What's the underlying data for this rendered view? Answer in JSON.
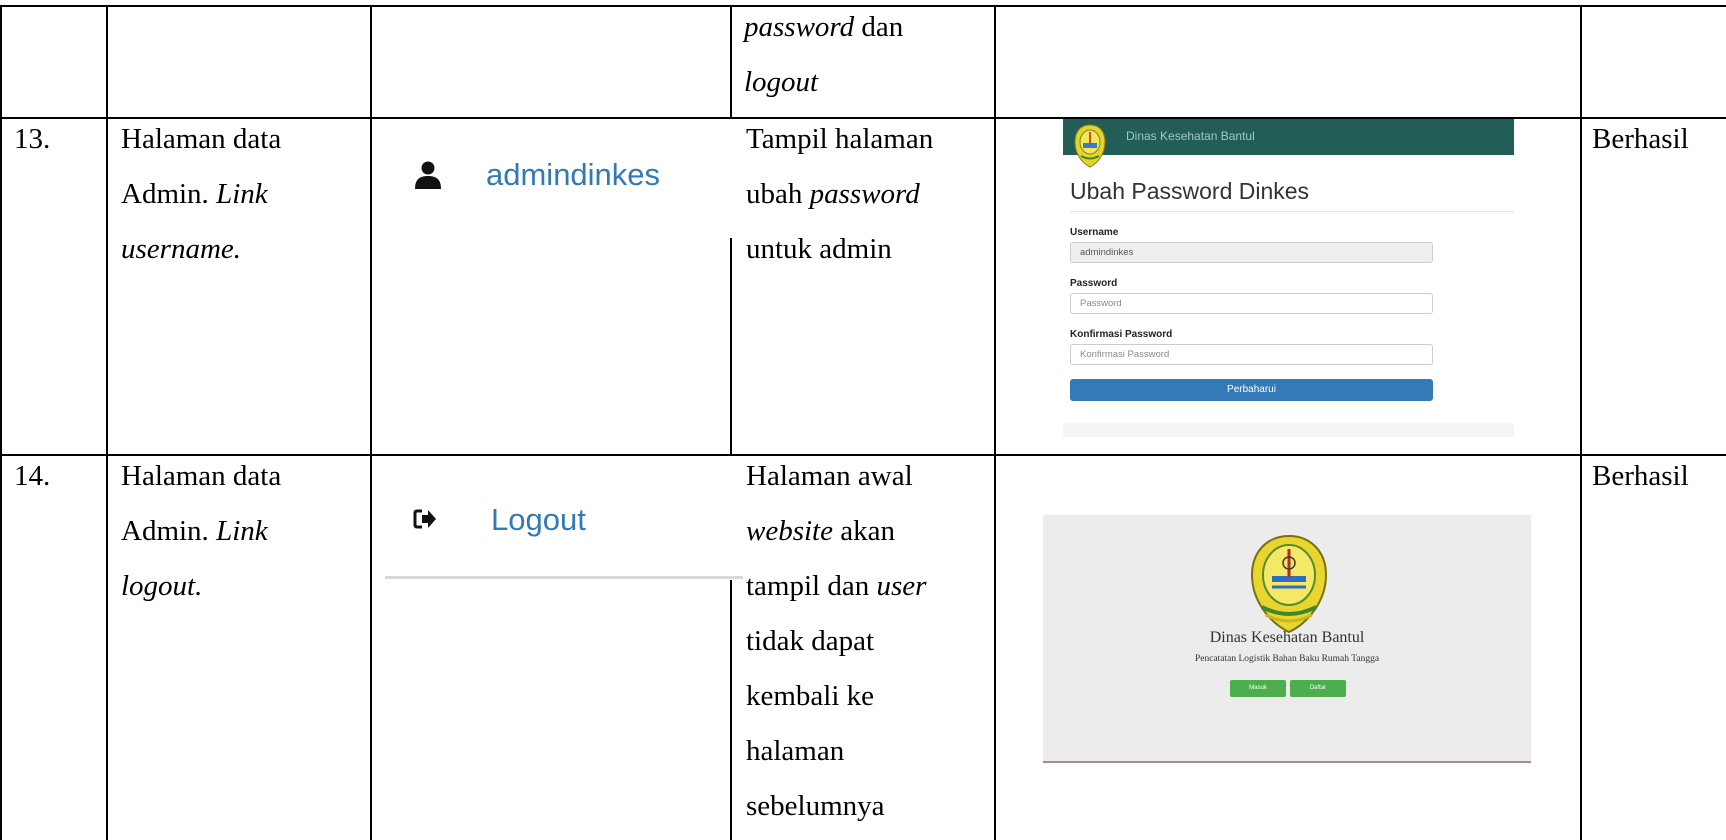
{
  "table": {
    "top_row": {
      "col3_line1": "password",
      "col3_line1_tail": " dan",
      "col3_line2": "logout"
    },
    "rows": [
      {
        "no": "13.",
        "desc_line1": "Halaman data",
        "desc_line2_plain": "Admin. ",
        "desc_line2_italic": "Link",
        "desc_line3_italic": "username.",
        "link_label": "admindinkes",
        "link_icon": "user-icon",
        "result_line1": "Tampil halaman",
        "result_line2_plain": "ubah ",
        "result_line2_italic": "password",
        "result_line3": "untuk admin",
        "status": "Berhasil"
      },
      {
        "no": "14.",
        "desc_line1": "Halaman data",
        "desc_line2_plain": "Admin. ",
        "desc_line2_italic": "Link",
        "desc_line3_italic": "logout.",
        "link_label": "Logout",
        "link_icon": "sign-out-icon",
        "result_line1": "Halaman awal",
        "result_line2_italic": "website",
        "result_line2_plain": " akan",
        "result_line3_plain": "tampil dan ",
        "result_line3_italic": "user",
        "result_line4": "tidak dapat",
        "result_line5": "kembali ke",
        "result_line6": "halaman",
        "result_line7": "sebelumnya",
        "status": "Berhasil"
      }
    ]
  },
  "screenshot13": {
    "header_title": "Dinas Kesehatan Bantul",
    "page_title": "Ubah Password Dinkes",
    "username_label": "Username",
    "username_value": "admindinkes",
    "password_label": "Password",
    "password_placeholder": "Password",
    "confirm_label": "Konfirmasi Password",
    "confirm_placeholder": "Konfirmasi Password",
    "submit_label": "Perbaharui",
    "header_color": "#225e57",
    "button_color": "#337ab7"
  },
  "screenshot14": {
    "title": "Dinas Kesehatan Bantul",
    "subtitle": "Pencatatan Logistik Bahan Baku Rumah Tangga",
    "login_label": "Masuk",
    "register_label": "Daftar",
    "button_color": "#4cae4c"
  }
}
